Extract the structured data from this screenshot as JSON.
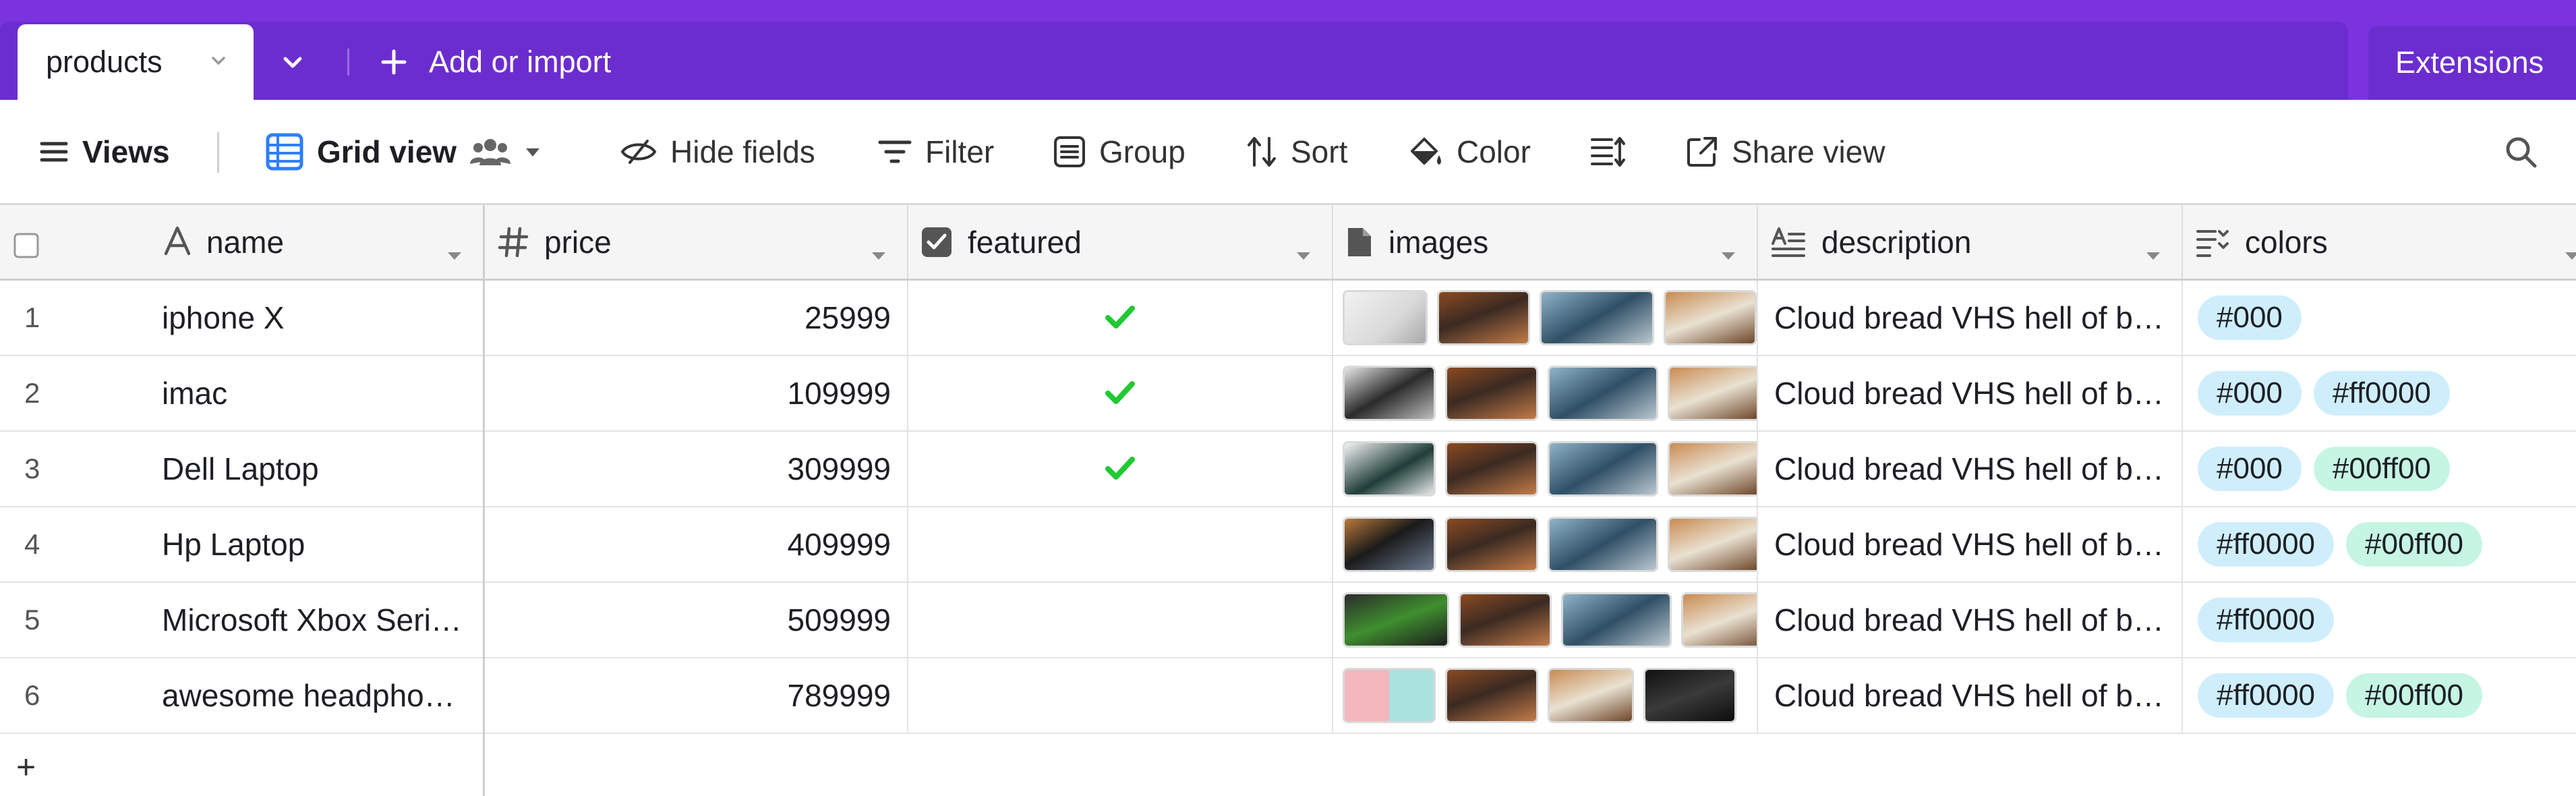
{
  "table_tab": {
    "label": "products"
  },
  "add_import": {
    "label": "Add or import"
  },
  "extensions": {
    "label": "Extensions"
  },
  "toolbar": {
    "views": "Views",
    "grid_view": "Grid view",
    "hide_fields": "Hide fields",
    "filter": "Filter",
    "group": "Group",
    "sort": "Sort",
    "color": "Color",
    "share_view": "Share view"
  },
  "columns": [
    {
      "label": "name",
      "icon": "text-type-icon"
    },
    {
      "label": "price",
      "icon": "hash-icon"
    },
    {
      "label": "featured",
      "icon": "checkbox-icon"
    },
    {
      "label": "images",
      "icon": "attachment-icon"
    },
    {
      "label": "description",
      "icon": "long-text-icon"
    },
    {
      "label": "colors",
      "icon": "multiselect-icon"
    }
  ],
  "rows": [
    {
      "num": "1",
      "name": "iphone X",
      "price": "25999",
      "featured": true,
      "description": "Cloud bread VHS hell of b…",
      "colors": [
        "#000"
      ]
    },
    {
      "num": "2",
      "name": "imac",
      "price": "109999",
      "featured": true,
      "description": "Cloud bread VHS hell of b…",
      "colors": [
        "#000",
        "#ff0000"
      ]
    },
    {
      "num": "3",
      "name": "Dell Laptop",
      "price": "309999",
      "featured": true,
      "description": "Cloud bread VHS hell of b…",
      "colors": [
        "#000",
        "#00ff00"
      ]
    },
    {
      "num": "4",
      "name": "Hp Laptop",
      "price": "409999",
      "featured": false,
      "description": "Cloud bread VHS hell of b…",
      "colors": [
        "#ff0000",
        "#00ff00"
      ]
    },
    {
      "num": "5",
      "name": "Microsoft Xbox Seri…",
      "price": "509999",
      "featured": false,
      "description": "Cloud bread VHS hell of b…",
      "colors": [
        "#ff0000"
      ]
    },
    {
      "num": "6",
      "name": "awesome headpho…",
      "price": "789999",
      "featured": false,
      "description": "Cloud bread VHS hell of b…",
      "colors": [
        "#ff0000",
        "#00ff00"
      ]
    }
  ],
  "add_row": {
    "label": "+"
  },
  "theme": {
    "topbar": "#7a33df",
    "chip_blue": "#cfeefc",
    "chip_green": "#c6f5e4",
    "check_green": "#20c933"
  }
}
